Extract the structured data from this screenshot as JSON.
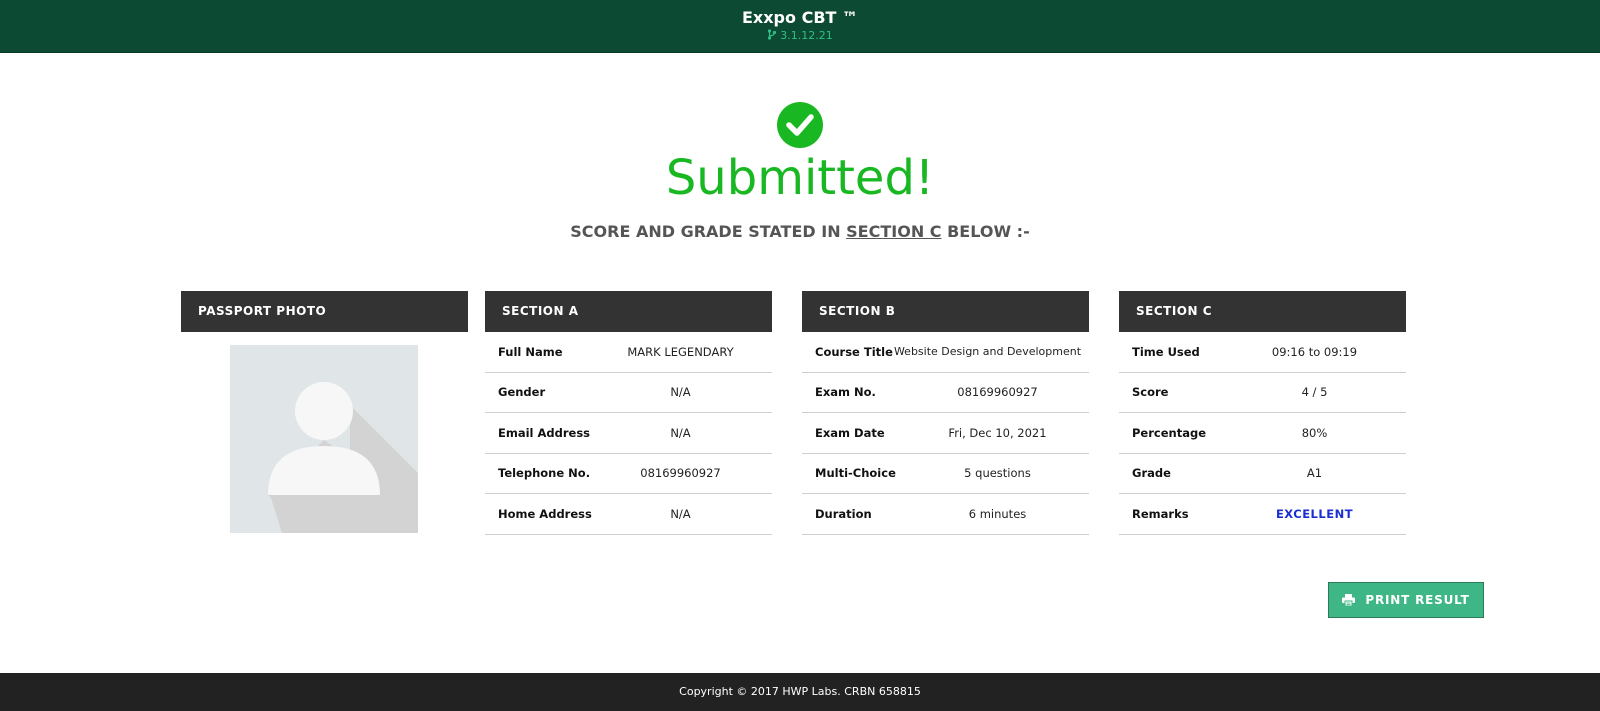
{
  "header": {
    "app_title": "Exxpo CBT ™",
    "version": "3.1.12.21",
    "branch_icon": "code-branch-icon"
  },
  "status": {
    "icon": "check-circle-icon",
    "headline": "Submitted!",
    "subline_prefix": "SCORE AND GRADE STATED IN ",
    "subline_link": "SECTION C",
    "subline_suffix": " BELOW :-"
  },
  "passport": {
    "title": "PASSPORT PHOTO",
    "image": "avatar-placeholder"
  },
  "section_a": {
    "title": "SECTION A",
    "rows": [
      {
        "label": "Full Name",
        "value": "MARK LEGENDARY"
      },
      {
        "label": "Gender",
        "value": "N/A"
      },
      {
        "label": "Email Address",
        "value": "N/A"
      },
      {
        "label": "Telephone No.",
        "value": "08169960927"
      },
      {
        "label": "Home Address",
        "value": "N/A"
      }
    ]
  },
  "section_b": {
    "title": "SECTION B",
    "rows": [
      {
        "label": "Course Title",
        "value": "Website Design and Development"
      },
      {
        "label": "Exam No.",
        "value": "08169960927"
      },
      {
        "label": "Exam Date",
        "value": "Fri, Dec 10, 2021"
      },
      {
        "label": "Multi-Choice",
        "value": "5 questions"
      },
      {
        "label": "Duration",
        "value": "6 minutes"
      }
    ]
  },
  "section_c": {
    "title": "SECTION C",
    "rows": [
      {
        "label": "Time Used",
        "value": "09:16 to 09:19"
      },
      {
        "label": "Score",
        "value": "4 / 5"
      },
      {
        "label": "Percentage",
        "value": "80%"
      },
      {
        "label": "Grade",
        "value": "A1"
      },
      {
        "label": "Remarks",
        "value": "EXCELLENT"
      }
    ]
  },
  "actions": {
    "print_label": "PRINT RESULT",
    "print_icon": "printer-icon"
  },
  "footer": {
    "copyright": "Copyright © 2017 HWP Labs. CRBN 658815"
  },
  "colors": {
    "header_bg": "#0c4a33",
    "success": "#19b823",
    "panel_head": "#333333",
    "button": "#3fb686",
    "remark": "#1a2ed1",
    "footer_bg": "#222222"
  }
}
